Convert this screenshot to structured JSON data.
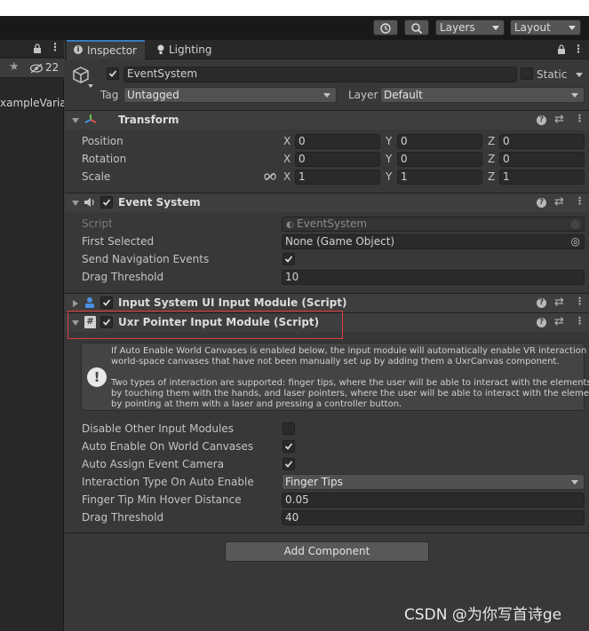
{
  "toolbar": {
    "history_icon": "history-icon",
    "search_icon": "search-icon",
    "layers_label": "Layers",
    "layout_label": "Layout"
  },
  "left_panel": {
    "lock_icon": "lock-icon",
    "visibility_count": "22",
    "item_label": "xampleVaria"
  },
  "tabs": {
    "inspector": "Inspector",
    "lighting": "Lighting"
  },
  "gameobject": {
    "name": "EventSystem",
    "static_label": "Static",
    "tag_label": "Tag",
    "tag_value": "Untagged",
    "layer_label": "Layer",
    "layer_value": "Default",
    "active": true
  },
  "transform": {
    "title": "Transform",
    "rows": [
      {
        "label": "Position",
        "x": "0",
        "y": "0",
        "z": "0"
      },
      {
        "label": "Rotation",
        "x": "0",
        "y": "0",
        "z": "0"
      },
      {
        "label": "Scale",
        "x": "1",
        "y": "1",
        "z": "1"
      }
    ],
    "axis_x": "X",
    "axis_y": "Y",
    "axis_z": "Z"
  },
  "event_system": {
    "title": "Event System",
    "script_label": "Script",
    "script_value": "EventSystem",
    "first_selected_label": "First Selected",
    "first_selected_value": "None (Game Object)",
    "send_nav_label": "Send Navigation Events",
    "send_nav_checked": true,
    "drag_threshold_label": "Drag Threshold",
    "drag_threshold_value": "10"
  },
  "input_system_module": {
    "title": "Input System UI Input Module (Script)"
  },
  "uxr_module": {
    "title": "Uxr Pointer Input Module (Script)",
    "help_lines": [
      "If Auto Enable World Canvases is enabled below, the input module will automatically enable VR interaction on",
      "world-space canvases that have not been manually set up by adding them a UxrCanvas component.",
      "",
      "Two types of interaction are supported: finger tips, where the user will be able to interact with the elements",
      "by touching them with the hands, and laser pointers, where the user will be able to interact with the elements",
      "by pointing at them with a laser and pressing a controller button."
    ],
    "disable_other_label": "Disable Other Input Modules",
    "disable_other_checked": false,
    "auto_enable_label": "Auto Enable On World Canvases",
    "auto_enable_checked": true,
    "auto_assign_label": "Auto Assign Event Camera",
    "auto_assign_checked": true,
    "interaction_type_label": "Interaction Type On Auto Enable",
    "interaction_type_value": "Finger Tips",
    "finger_tip_label": "Finger Tip Min Hover Distance",
    "finger_tip_value": "0.05",
    "drag_threshold_label": "Drag Threshold",
    "drag_threshold_value": "40"
  },
  "add_component_label": "Add Component",
  "watermark": "CSDN @为你写首诗ge",
  "colors": {
    "highlight_box": "#e03c3c",
    "active_tab_accent": "#3a79bb"
  }
}
